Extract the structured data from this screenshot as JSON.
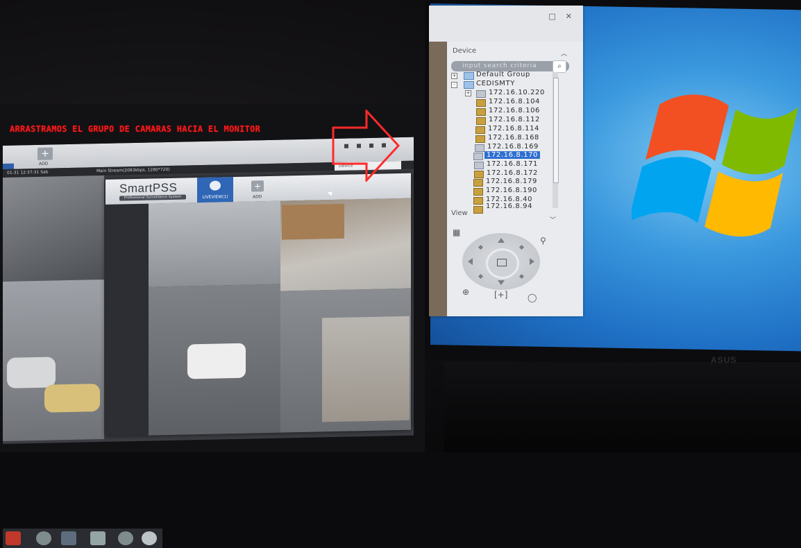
{
  "annotation": {
    "text": "ARRASTRAMOS EL GRUPO DE CAMARAS HACIA EL MONITOR",
    "color": "#ff1a1a"
  },
  "left_monitor": {
    "outer_toolbar": {
      "add_label": "ADD",
      "stream_info": "Main Stream(2083kbps, 1280*720)",
      "timestamp": "01-31 12:37:31 Sab",
      "device_label": "Device"
    },
    "smartpss": {
      "brand_name": "SmartPSS",
      "brand_tagline": "Professional Surveillance System",
      "live_tab_label": "LIVEVIEW(1)",
      "add_label": "ADD"
    }
  },
  "right_panel": {
    "device_section_title": "Device",
    "search_placeholder": "input search criteria",
    "tree": [
      {
        "label": "Default Group",
        "type": "group",
        "expander": "+"
      },
      {
        "label": "CEDISMTY",
        "type": "group",
        "expander": "-"
      },
      {
        "label": "172.16.10.220",
        "type": "device",
        "expander": "+"
      },
      {
        "label": "172.16.8.104",
        "type": "camera"
      },
      {
        "label": "172.16.8.106",
        "type": "camera"
      },
      {
        "label": "172.16.8.112",
        "type": "camera"
      },
      {
        "label": "172.16.8.114",
        "type": "camera"
      },
      {
        "label": "172.16.8.168",
        "type": "camera"
      },
      {
        "label": "172.16.8.169",
        "type": "camera"
      },
      {
        "label": "172.16.8.170",
        "type": "camera",
        "selected": true
      },
      {
        "label": "172.16.8.171",
        "type": "camera"
      },
      {
        "label": "172.16.8.172",
        "type": "camera"
      },
      {
        "label": "172.16.8.179",
        "type": "camera"
      },
      {
        "label": "172.16.8.190",
        "type": "camera"
      },
      {
        "label": "172.16.8.40",
        "type": "camera"
      },
      {
        "label": "172.16.8.94",
        "type": "camera"
      }
    ],
    "view_section_title": "View",
    "selection_color": "#2f6fd0"
  },
  "colors": {
    "accent_blue": "#2f66b6",
    "desktop_blue": "#3a98de"
  }
}
